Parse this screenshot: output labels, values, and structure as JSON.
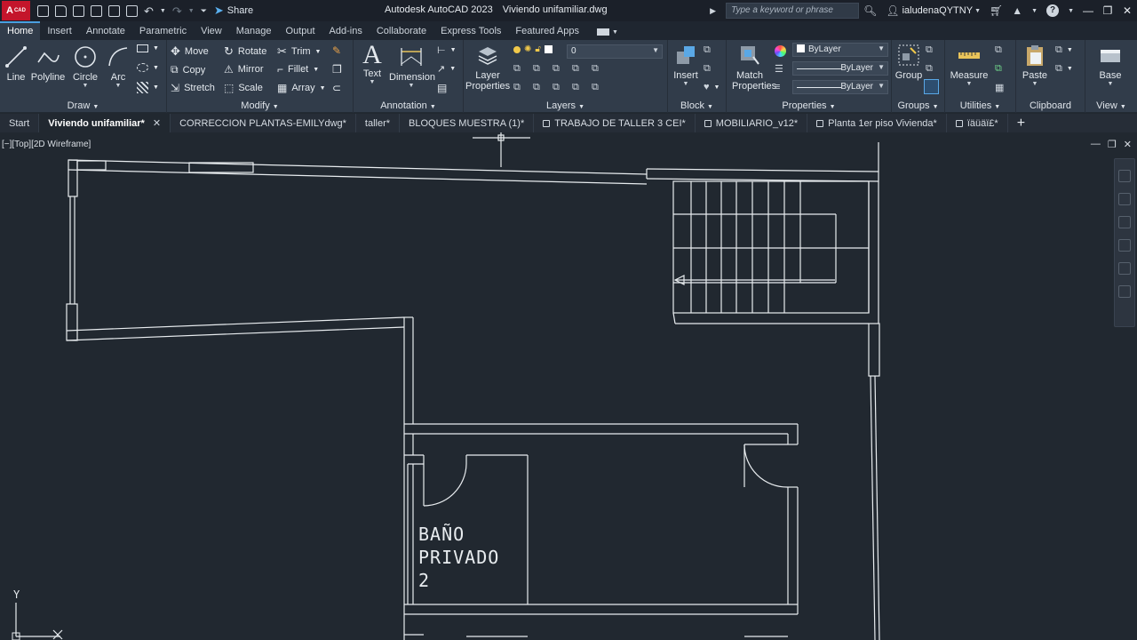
{
  "app": {
    "logo_text": "A",
    "logo_sub": "CAD",
    "title_app": "Autodesk AutoCAD 2023",
    "title_file": "Viviendo unifamiliar.dwg",
    "share_label": "Share",
    "search_placeholder": "Type a keyword or phrase",
    "user_name": "ialudenaQYTNY"
  },
  "ribbon_tabs": [
    "Home",
    "Insert",
    "Annotate",
    "Parametric",
    "View",
    "Manage",
    "Output",
    "Add-ins",
    "Collaborate",
    "Express Tools",
    "Featured Apps"
  ],
  "ribbon": {
    "draw": {
      "title": "Draw",
      "line": "Line",
      "polyline": "Polyline",
      "circle": "Circle",
      "arc": "Arc"
    },
    "modify": {
      "title": "Modify",
      "move": "Move",
      "rotate": "Rotate",
      "trim": "Trim",
      "copy": "Copy",
      "mirror": "Mirror",
      "fillet": "Fillet",
      "stretch": "Stretch",
      "scale": "Scale",
      "array": "Array"
    },
    "annotation": {
      "title": "Annotation",
      "text": "Text",
      "dimension": "Dimension"
    },
    "layers": {
      "title": "Layers",
      "layer_properties_1": "Layer",
      "layer_properties_2": "Properties",
      "current_layer": "0"
    },
    "block": {
      "title": "Block",
      "insert": "Insert"
    },
    "properties": {
      "title": "Properties",
      "match_1": "Match",
      "match_2": "Properties",
      "color": "ByLayer",
      "linetype": "ByLayer",
      "lineweight": "ByLayer"
    },
    "groups": {
      "title": "Groups",
      "group": "Group"
    },
    "utilities": {
      "title": "Utilities",
      "measure": "Measure"
    },
    "clipboard": {
      "title": "Clipboard",
      "paste": "Paste"
    },
    "view": {
      "title": "View",
      "base": "Base"
    }
  },
  "file_tabs": [
    {
      "label": "Start",
      "locked": false,
      "active": false
    },
    {
      "label": "Viviendo unifamiliar*",
      "locked": false,
      "active": true
    },
    {
      "label": "CORRECCION PLANTAS-EMILYdwg*",
      "locked": false,
      "active": false
    },
    {
      "label": "taller*",
      "locked": false,
      "active": false
    },
    {
      "label": "BLOQUES MUESTRA (1)*",
      "locked": false,
      "active": false
    },
    {
      "label": "TRABAJO DE TALLER 3 CEI*",
      "locked": true,
      "active": false
    },
    {
      "label": "MOBILIARIO_v12*",
      "locked": true,
      "active": false
    },
    {
      "label": "Planta 1er piso Vivienda*",
      "locked": true,
      "active": false
    },
    {
      "label": "ïäüäï£*",
      "locked": true,
      "active": false
    }
  ],
  "viewport": {
    "label": "[−][Top][2D Wireframe]",
    "room_label_line1": "BAÑO",
    "room_label_line2": "PRIVADO",
    "room_label_line3": "2",
    "ucs_y": "Y"
  },
  "colors": {
    "background": "#212830",
    "ribbon": "#313c4a",
    "accent": "#4a9fe0",
    "logo_red": "#c4152b",
    "linework": "#e8ecef"
  }
}
